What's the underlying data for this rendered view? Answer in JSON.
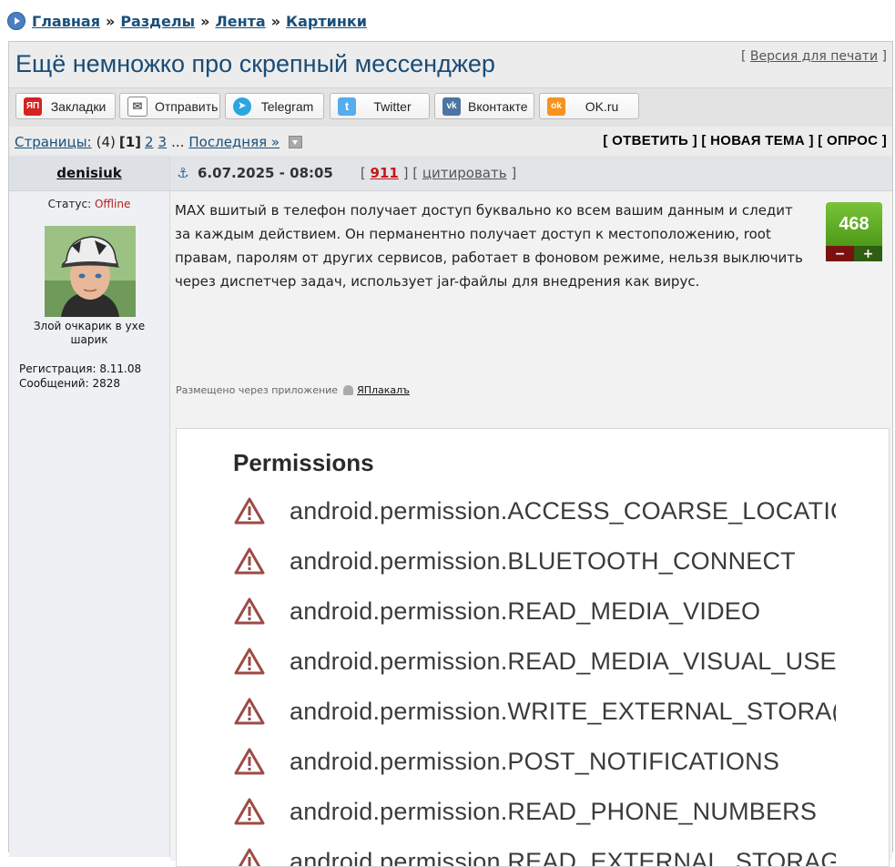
{
  "breadcrumb": {
    "items": [
      "Главная",
      "Разделы",
      "Лента",
      "Картинки"
    ],
    "separator": "»"
  },
  "topic": {
    "title": "Ещё немножко про скрепный мессенджер",
    "print_link": "Версия для печати"
  },
  "share": {
    "buttons": [
      {
        "label": "Закладки",
        "icon": "yaplakal-icon",
        "icon_text": "ЯП",
        "color": "#d6231f"
      },
      {
        "label": "Отправить",
        "icon": "mail-icon",
        "icon_text": "✉",
        "color": "#8a8a8a"
      },
      {
        "label": "Telegram",
        "icon": "telegram-icon",
        "icon_text": "➤",
        "color": "#2ca5e0"
      },
      {
        "label": "Twitter",
        "icon": "twitter-icon",
        "icon_text": "t",
        "color": "#55acee"
      },
      {
        "label": "Вконтакте",
        "icon": "vk-icon",
        "icon_text": "vk",
        "color": "#4c75a3"
      },
      {
        "label": "OK.ru",
        "icon": "ok-icon",
        "icon_text": "ok",
        "color": "#f7931e"
      }
    ]
  },
  "pages": {
    "label": "Страницы:",
    "count": "(4)",
    "current": "[1]",
    "links": [
      "2",
      "3"
    ],
    "ellipsis": "...",
    "last": "Последняя »"
  },
  "actions": {
    "reply": "[ ОТВЕТИТЬ ]",
    "new_topic": "[ НОВАЯ ТЕМА ]",
    "poll": "[ ОПРОС ]"
  },
  "author": {
    "name": "denisiuk",
    "status_label": "Статус:",
    "status_value": "Offline",
    "avatar_caption": "Злой очкарик в ухе шарик",
    "registration": "Регистрация: 8.11.08",
    "messages": "Сообщений: 2828"
  },
  "post": {
    "date": "6.07.2025 - 08:05",
    "number": "911",
    "quote": "цитировать",
    "text": "MAX вшитый в телефон получает доступ буквально ко всем вашим данным и следит за каждым действием. Он перманентно получает доступ к местоположению, root правам, паролям от других сервисов, работает в фоновом режиме, нельзя выключить через диспетчер задач, использует jar-файлы для внедрения как вирус.",
    "rating": "468",
    "via_label": "Размещено через приложение",
    "via_app": "ЯПлакалъ"
  },
  "image": {
    "title": "Permissions",
    "permissions": [
      "android.permission.ACCESS_COARSE_LOCATIC",
      "android.permission.BLUETOOTH_CONNECT",
      "android.permission.READ_MEDIA_VIDEO",
      "android.permission.READ_MEDIA_VISUAL_USE",
      "android.permission.WRITE_EXTERNAL_STORA(",
      "android.permission.POST_NOTIFICATIONS",
      "android.permission.READ_PHONE_NUMBERS",
      "android.permission.READ_EXTERNAL_STORAG"
    ]
  },
  "colors": {
    "title": "#194c76",
    "link": "#1a4f7a",
    "offline": "#b22222",
    "rating_green": "#5aa91f",
    "warning": "#9c4b45"
  }
}
